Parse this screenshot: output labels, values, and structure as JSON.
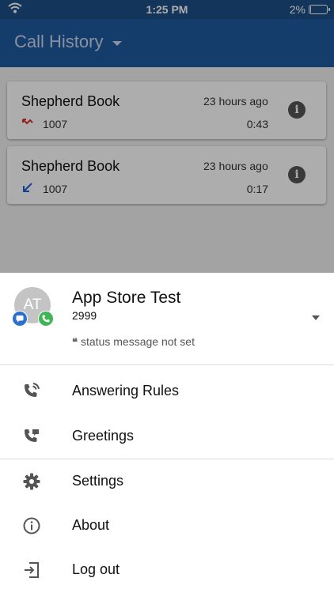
{
  "status_bar": {
    "time": "1:25 PM",
    "battery_text": "2%",
    "battery_level": 0.02,
    "wifi_icon": "wifi-icon"
  },
  "header": {
    "title": "Call History",
    "dropdown_icon": "caret-down-icon",
    "color": "#1f5aa0"
  },
  "calls": [
    {
      "name": "Shepherd Book",
      "time": "23 hours ago",
      "number": "1007",
      "duration": "0:43",
      "direction": "missed",
      "icon": "missed-call-icon",
      "icon_color": "#d93025"
    },
    {
      "name": "Shepherd Book",
      "time": "23 hours ago",
      "number": "1007",
      "duration": "0:17",
      "direction": "incoming",
      "icon": "incoming-call-icon",
      "icon_color": "#1a5fd1"
    }
  ],
  "profile": {
    "initials": "AT",
    "name": "App Store Test",
    "extension": "2999",
    "status_message": "status message not set",
    "chat_badge_color": "#2d6fd1",
    "phone_badge_color": "#3eb655"
  },
  "menu": [
    {
      "label": "Answering Rules",
      "icon": "answering-rules-icon"
    },
    {
      "label": "Greetings",
      "icon": "greetings-icon"
    },
    {
      "label": "Settings",
      "icon": "gear-icon"
    },
    {
      "label": "About",
      "icon": "info-icon"
    },
    {
      "label": "Log out",
      "icon": "logout-icon"
    }
  ]
}
